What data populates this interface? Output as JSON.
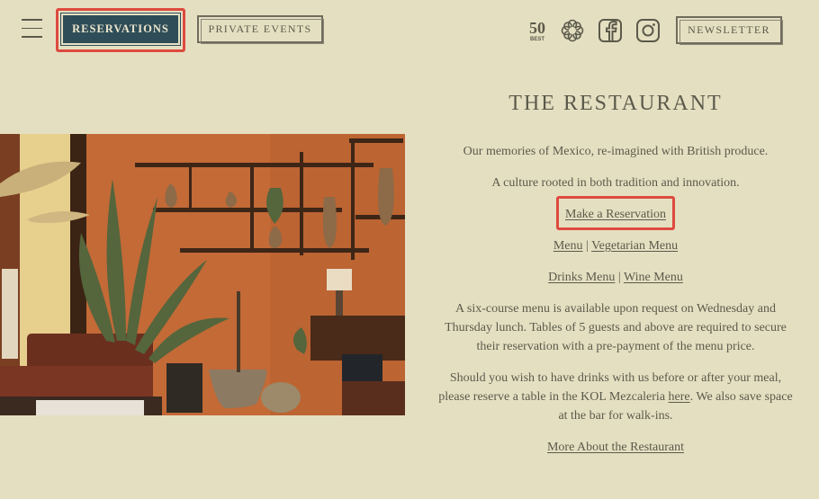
{
  "header": {
    "reservations_label": "RESERVATIONS",
    "private_events_label": "PRIVATE EVENTS",
    "newsletter_label": "NEWSLETTER",
    "award_badge_number": "50",
    "award_badge_text": "BEST",
    "icons": [
      "menu-icon",
      "award-badge-icon",
      "michelin-flower-icon",
      "facebook-icon",
      "instagram-icon"
    ]
  },
  "restaurant": {
    "title": "THE RESTAURANT",
    "intro_1": "Our memories of Mexico, re-imagined with British produce.",
    "intro_2": "A culture rooted in both tradition and innovation.",
    "make_reservation": "Make a Reservation",
    "menu": "Menu",
    "vegetarian_menu": "Vegetarian Menu",
    "drinks_menu": "Drinks Menu",
    "wine_menu": "Wine Menu",
    "separator": "|",
    "info_1": "A six-course menu is available upon request on Wednesday and Thursday lunch. Tables of 5 guests and above are required to secure their reservation with a pre-payment of the menu price.",
    "info_2_before": "Should you wish to have drinks with us before or after your meal, please reserve a table in the KOL Mezcaleria ",
    "info_2_link": "here",
    "info_2_after": ". We also save space at the bar for walk-ins.",
    "more_about": "More About the Restaurant"
  },
  "colors": {
    "background": "#e5dfc2",
    "button_fill": "#2e4d58",
    "text": "#5b5a4a",
    "highlight": "#dd4a3f",
    "wall": "#c36a37"
  }
}
